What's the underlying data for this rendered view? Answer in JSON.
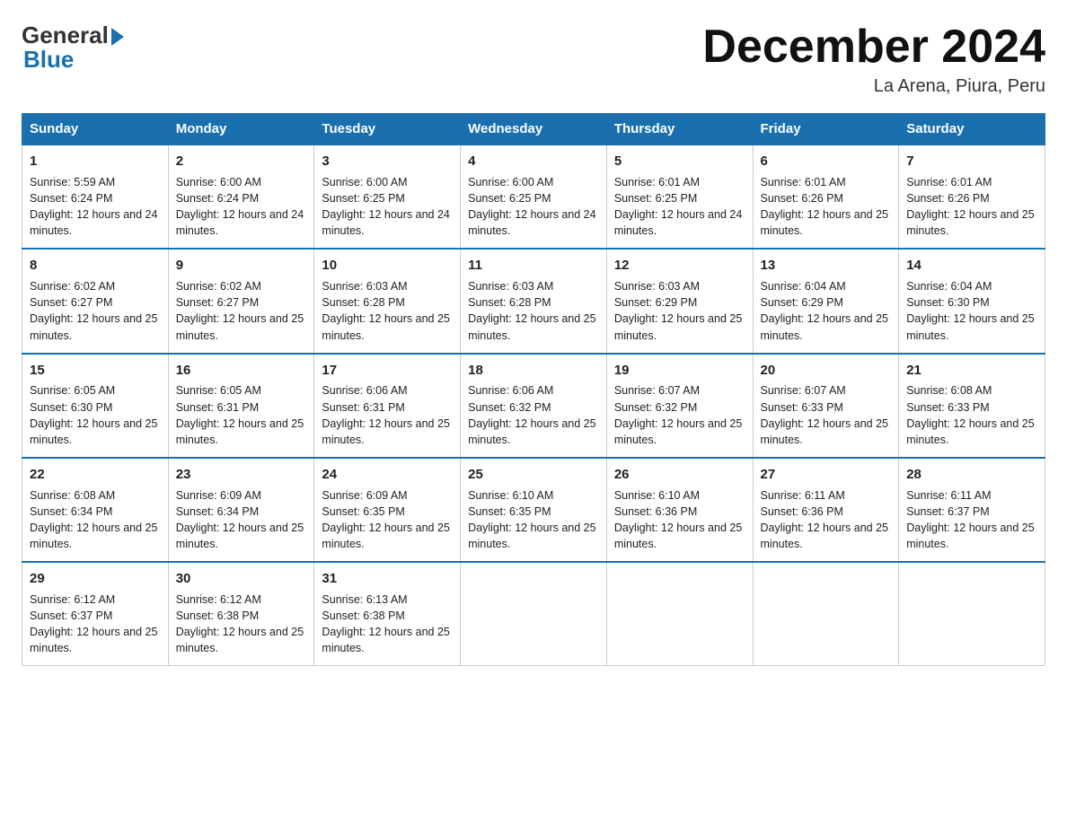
{
  "logo": {
    "general": "General",
    "blue": "Blue"
  },
  "title": {
    "month_year": "December 2024",
    "location": "La Arena, Piura, Peru"
  },
  "weekdays": [
    "Sunday",
    "Monday",
    "Tuesday",
    "Wednesday",
    "Thursday",
    "Friday",
    "Saturday"
  ],
  "weeks": [
    [
      {
        "day": "1",
        "sunrise": "5:59 AM",
        "sunset": "6:24 PM",
        "daylight": "12 hours and 24 minutes."
      },
      {
        "day": "2",
        "sunrise": "6:00 AM",
        "sunset": "6:24 PM",
        "daylight": "12 hours and 24 minutes."
      },
      {
        "day": "3",
        "sunrise": "6:00 AM",
        "sunset": "6:25 PM",
        "daylight": "12 hours and 24 minutes."
      },
      {
        "day": "4",
        "sunrise": "6:00 AM",
        "sunset": "6:25 PM",
        "daylight": "12 hours and 24 minutes."
      },
      {
        "day": "5",
        "sunrise": "6:01 AM",
        "sunset": "6:25 PM",
        "daylight": "12 hours and 24 minutes."
      },
      {
        "day": "6",
        "sunrise": "6:01 AM",
        "sunset": "6:26 PM",
        "daylight": "12 hours and 25 minutes."
      },
      {
        "day": "7",
        "sunrise": "6:01 AM",
        "sunset": "6:26 PM",
        "daylight": "12 hours and 25 minutes."
      }
    ],
    [
      {
        "day": "8",
        "sunrise": "6:02 AM",
        "sunset": "6:27 PM",
        "daylight": "12 hours and 25 minutes."
      },
      {
        "day": "9",
        "sunrise": "6:02 AM",
        "sunset": "6:27 PM",
        "daylight": "12 hours and 25 minutes."
      },
      {
        "day": "10",
        "sunrise": "6:03 AM",
        "sunset": "6:28 PM",
        "daylight": "12 hours and 25 minutes."
      },
      {
        "day": "11",
        "sunrise": "6:03 AM",
        "sunset": "6:28 PM",
        "daylight": "12 hours and 25 minutes."
      },
      {
        "day": "12",
        "sunrise": "6:03 AM",
        "sunset": "6:29 PM",
        "daylight": "12 hours and 25 minutes."
      },
      {
        "day": "13",
        "sunrise": "6:04 AM",
        "sunset": "6:29 PM",
        "daylight": "12 hours and 25 minutes."
      },
      {
        "day": "14",
        "sunrise": "6:04 AM",
        "sunset": "6:30 PM",
        "daylight": "12 hours and 25 minutes."
      }
    ],
    [
      {
        "day": "15",
        "sunrise": "6:05 AM",
        "sunset": "6:30 PM",
        "daylight": "12 hours and 25 minutes."
      },
      {
        "day": "16",
        "sunrise": "6:05 AM",
        "sunset": "6:31 PM",
        "daylight": "12 hours and 25 minutes."
      },
      {
        "day": "17",
        "sunrise": "6:06 AM",
        "sunset": "6:31 PM",
        "daylight": "12 hours and 25 minutes."
      },
      {
        "day": "18",
        "sunrise": "6:06 AM",
        "sunset": "6:32 PM",
        "daylight": "12 hours and 25 minutes."
      },
      {
        "day": "19",
        "sunrise": "6:07 AM",
        "sunset": "6:32 PM",
        "daylight": "12 hours and 25 minutes."
      },
      {
        "day": "20",
        "sunrise": "6:07 AM",
        "sunset": "6:33 PM",
        "daylight": "12 hours and 25 minutes."
      },
      {
        "day": "21",
        "sunrise": "6:08 AM",
        "sunset": "6:33 PM",
        "daylight": "12 hours and 25 minutes."
      }
    ],
    [
      {
        "day": "22",
        "sunrise": "6:08 AM",
        "sunset": "6:34 PM",
        "daylight": "12 hours and 25 minutes."
      },
      {
        "day": "23",
        "sunrise": "6:09 AM",
        "sunset": "6:34 PM",
        "daylight": "12 hours and 25 minutes."
      },
      {
        "day": "24",
        "sunrise": "6:09 AM",
        "sunset": "6:35 PM",
        "daylight": "12 hours and 25 minutes."
      },
      {
        "day": "25",
        "sunrise": "6:10 AM",
        "sunset": "6:35 PM",
        "daylight": "12 hours and 25 minutes."
      },
      {
        "day": "26",
        "sunrise": "6:10 AM",
        "sunset": "6:36 PM",
        "daylight": "12 hours and 25 minutes."
      },
      {
        "day": "27",
        "sunrise": "6:11 AM",
        "sunset": "6:36 PM",
        "daylight": "12 hours and 25 minutes."
      },
      {
        "day": "28",
        "sunrise": "6:11 AM",
        "sunset": "6:37 PM",
        "daylight": "12 hours and 25 minutes."
      }
    ],
    [
      {
        "day": "29",
        "sunrise": "6:12 AM",
        "sunset": "6:37 PM",
        "daylight": "12 hours and 25 minutes."
      },
      {
        "day": "30",
        "sunrise": "6:12 AM",
        "sunset": "6:38 PM",
        "daylight": "12 hours and 25 minutes."
      },
      {
        "day": "31",
        "sunrise": "6:13 AM",
        "sunset": "6:38 PM",
        "daylight": "12 hours and 25 minutes."
      },
      null,
      null,
      null,
      null
    ]
  ],
  "colors": {
    "header_bg": "#1a6faf",
    "accent_blue": "#1a6faf"
  }
}
